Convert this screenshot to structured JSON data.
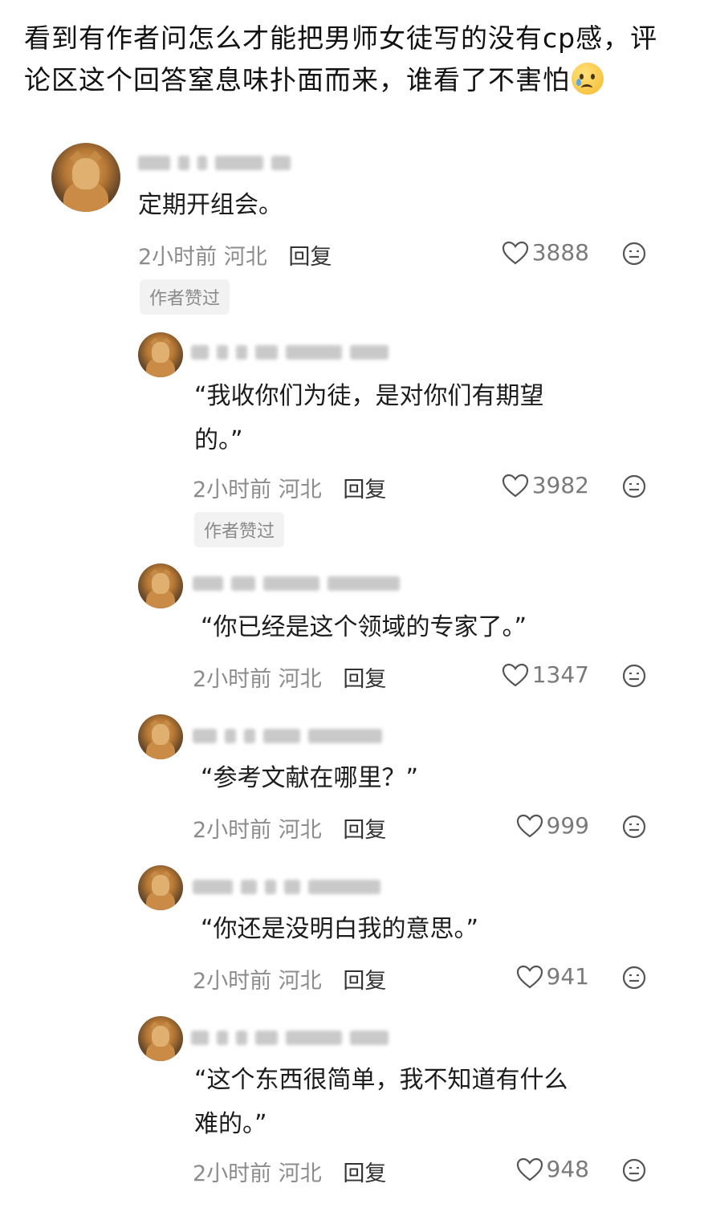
{
  "header": {
    "line1": "看到有作者问怎么才能把男师女徒写的没有cp感，评",
    "line2": "论区这个回答窒息味扑面而来，谁看了不害怕",
    "emoji_icon": "crying-face-icon"
  },
  "comments": [
    {
      "text": "定期开组会。",
      "time": "2小时前",
      "location": "河北",
      "reply_label": "回复",
      "likes": "3888",
      "tag": "作者赞过"
    },
    {
      "text_line1": "“我收你们为徒，是对你们有期望",
      "text_line2": "的。”",
      "time": "2小时前",
      "location": "河北",
      "reply_label": "回复",
      "likes": "3982",
      "tag": "作者赞过"
    },
    {
      "text": "“你已经是这个领域的专家了。”",
      "time": "2小时前",
      "location": "河北",
      "reply_label": "回复",
      "likes": "1347"
    },
    {
      "text": "“参考文献在哪里？”",
      "time": "2小时前",
      "location": "河北",
      "reply_label": "回复",
      "likes": "999"
    },
    {
      "text": "“你还是没明白我的意思。”",
      "time": "2小时前",
      "location": "河北",
      "reply_label": "回复",
      "likes": "941"
    },
    {
      "text_line1": "“这个东西很简单，我不知道有什么",
      "text_line2": "难的。”",
      "time": "2小时前",
      "location": "河北",
      "reply_label": "回复",
      "likes": "948"
    }
  ],
  "icons": {
    "like": "heart-outline-icon",
    "more": "dislike-face-icon"
  },
  "colors": {
    "meta_gray": "#8c8c8c",
    "text": "#1c1c1c",
    "tag_bg": "#f2f2f2"
  }
}
